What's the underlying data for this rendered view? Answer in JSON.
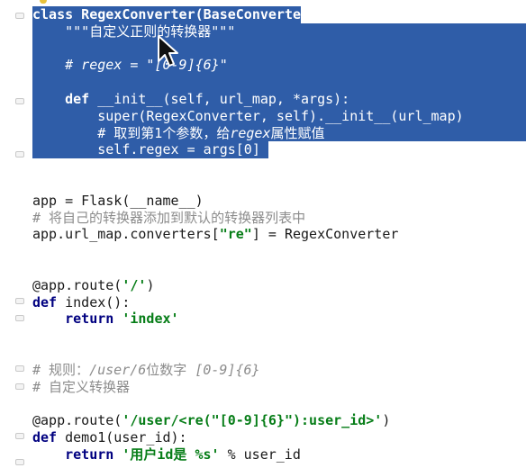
{
  "code_lines": {
    "l1": "class RegexConverter(BaseConverter):",
    "l2a": "    \"\"\"",
    "l2b": "自定义正则的转换器",
    "l2c": "\"\"\"",
    "l4": "    # regex = \"[0-9]{6}\"",
    "l6a": "    def",
    "l6b": " __init__(self, url_map, *args):",
    "l7": "        super(RegexConverter, self).__init__(url_map)",
    "l8a": "        # 取到第1个参数，给",
    "l8b": "regex",
    "l8c": "属性赋值",
    "l9": "        self.regex = args[0]",
    "l12": "app = Flask(__name__)",
    "l13": "# 将自己的转换器添加到默认的转换器列表中",
    "l14a": "app.url_map.converters[",
    "l14b": "\"re\"",
    "l14c": "] = RegexConverter",
    "l17a": "@app.route(",
    "l17b": "'/'",
    "l17c": ")",
    "l18a": "def",
    "l18b": " index():",
    "l19a": "    return",
    "l19b": " 'index'",
    "l22a": "# 规则：",
    "l22b": "/user/6",
    "l22c": "位数字",
    "l22d": " [0-9]{6}",
    "l23": "# 自定义转换器",
    "l25a": "@app.route(",
    "l25b": "'/user/<re(\"[0-9]{6}\"):user_id>'",
    "l25c": ")",
    "l26a": "def",
    "l26b": " demo1(user_id):",
    "l27a": "    return",
    "l27b": " '用户id是 %s'",
    "l27c": " % user_id"
  },
  "colors": {
    "selection": "#2f5da8",
    "keyword": "#000080",
    "string": "#067d17",
    "comment": "#8c8c8c",
    "decorator": "#808000"
  },
  "icons": [
    "lightbulb-icon",
    "fold-marker-icon",
    "mouse-cursor-icon"
  ]
}
